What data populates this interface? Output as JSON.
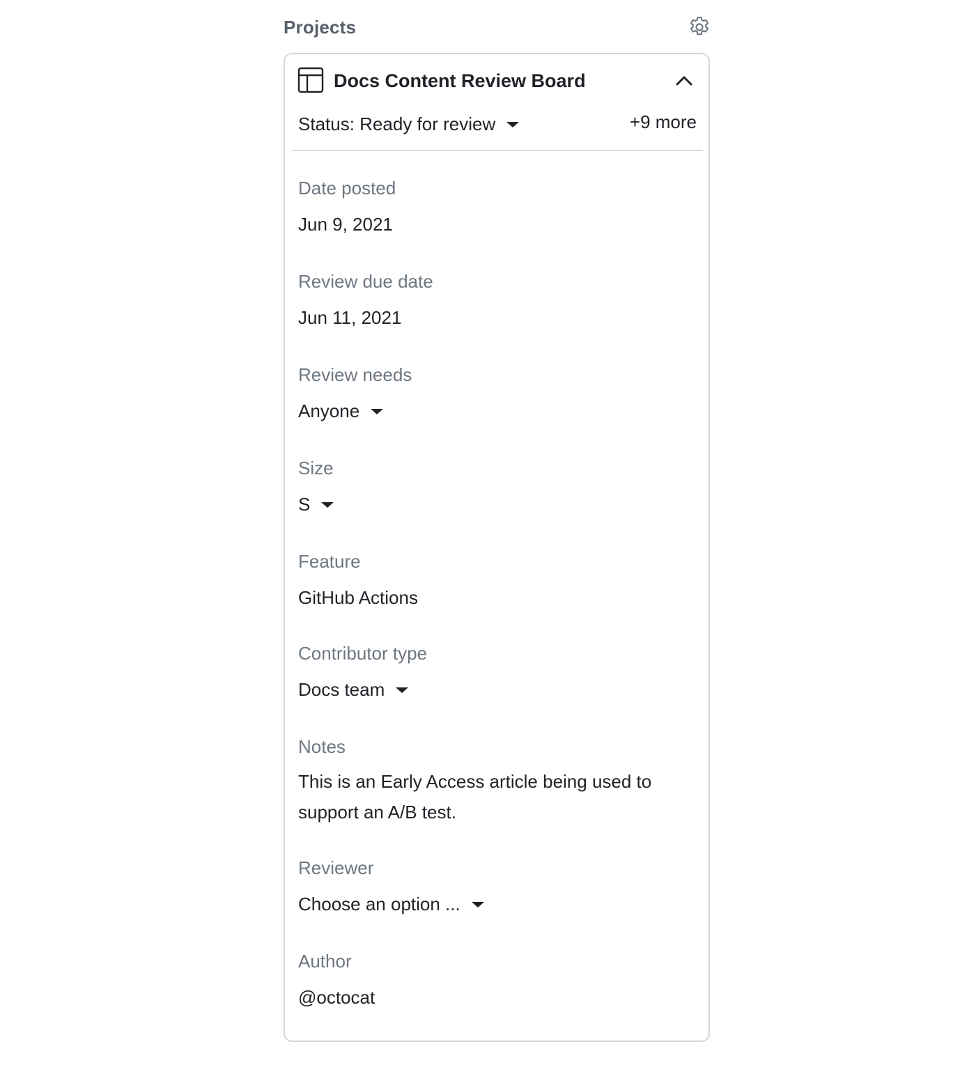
{
  "sidebar": {
    "title": "Projects",
    "settings_icon": "gear-icon"
  },
  "project": {
    "icon": "table-icon",
    "title": "Docs Content Review Board",
    "collapse_icon": "chevron-up-icon",
    "status": "Status: Ready for review",
    "more": "+9 more",
    "fields": {
      "date_posted": {
        "label": "Date posted",
        "value": "Jun 9, 2021"
      },
      "review_due_date": {
        "label": "Review due date",
        "value": "Jun 11, 2021"
      },
      "review_needs": {
        "label": "Review needs",
        "value": "Anyone"
      },
      "size": {
        "label": "Size",
        "value": "S"
      },
      "feature": {
        "label": "Feature",
        "value": "GitHub Actions"
      },
      "contributor_type": {
        "label": "Contributor type",
        "value": "Docs team"
      },
      "notes": {
        "label": "Notes",
        "value": "This is an Early Access article being used to support an A/B test."
      },
      "reviewer": {
        "label": "Reviewer",
        "value": "Choose an option ..."
      },
      "author": {
        "label": "Author",
        "value": "@octocat"
      }
    }
  },
  "colors": {
    "text_primary": "#1f2328",
    "text_muted": "#6e7781",
    "border": "#d0d7de"
  }
}
